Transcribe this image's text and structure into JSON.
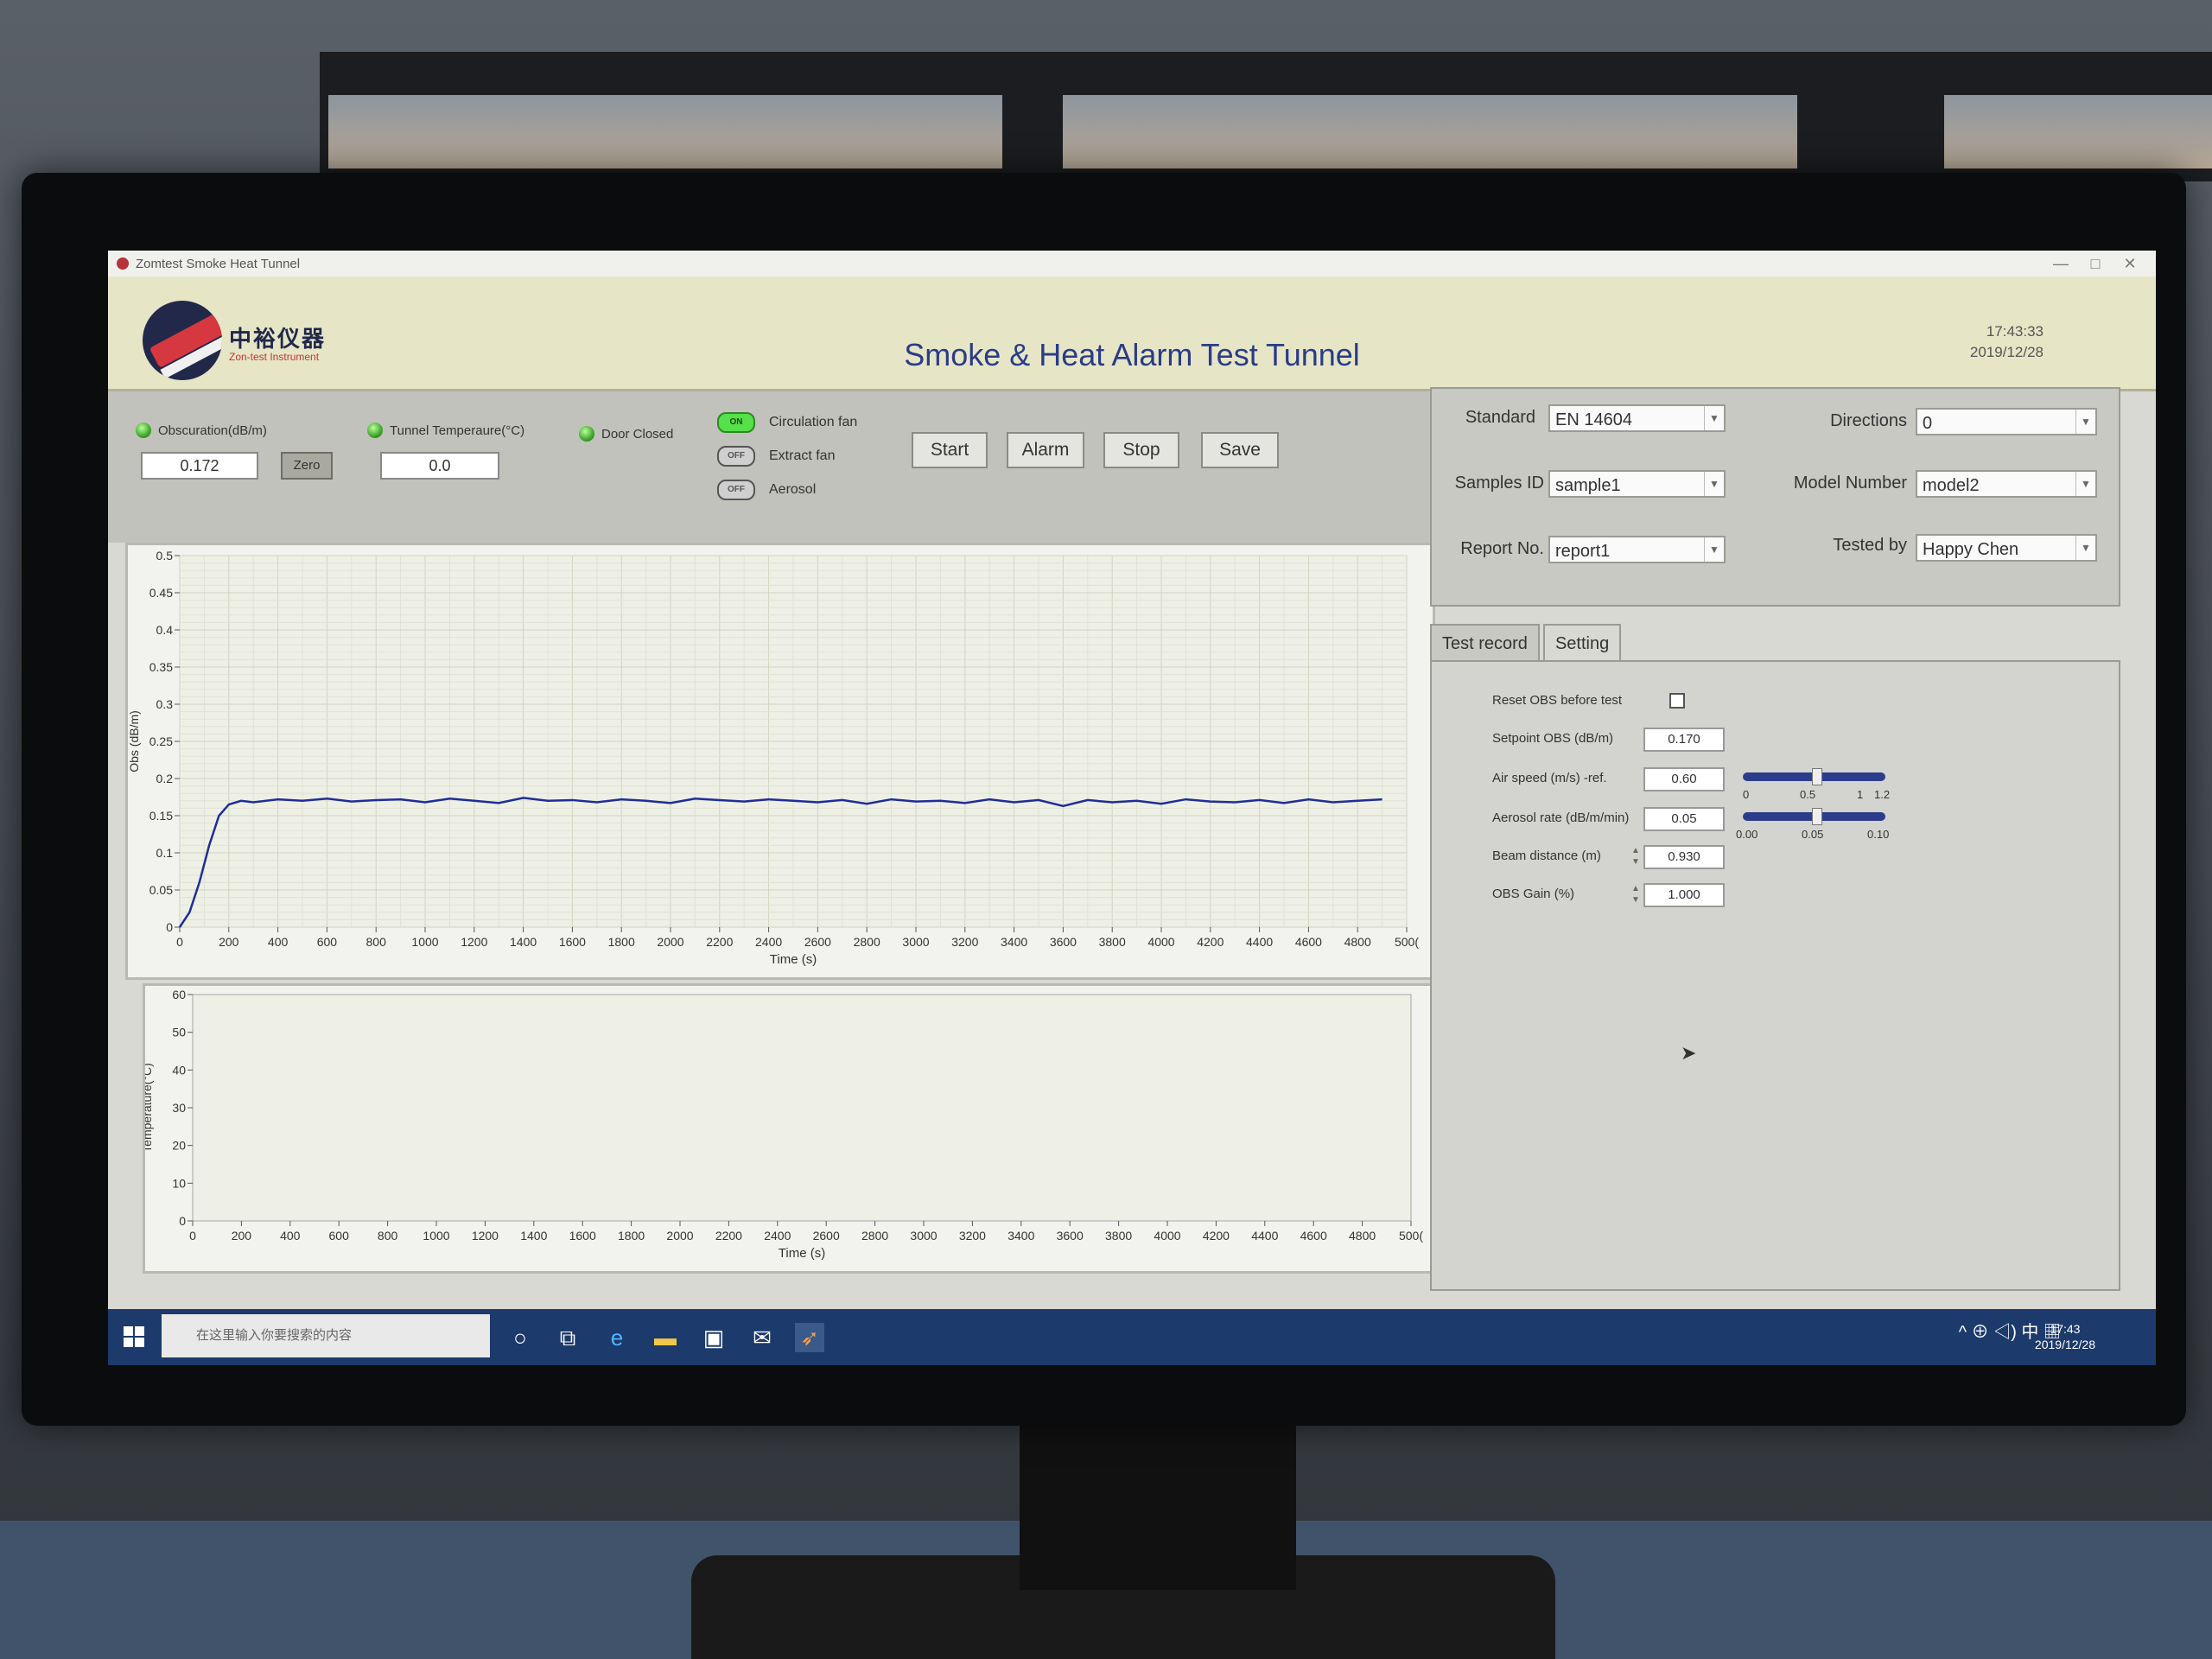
{
  "window": {
    "title": "Zomtest Smoke Heat Tunnel",
    "minimize": "—",
    "maximize": "□",
    "close": "✕"
  },
  "header": {
    "logo_text": "中裕仪器",
    "logo_sub": "Zon-test Instrument",
    "title": "Smoke & Heat Alarm Test Tunnel",
    "time": "17:43:33",
    "date": "2019/12/28"
  },
  "indicators": {
    "obscuration_label": "Obscuration(dB/m)",
    "obscuration_value": "0.172",
    "zero_label": "Zero",
    "temperature_label": "Tunnel Temperaure(°C)",
    "temperature_value": "0.0",
    "door_label": "Door Closed"
  },
  "toggles": [
    {
      "label": "Circulation fan",
      "state": "ON"
    },
    {
      "label": "Extract fan",
      "state": "OFF"
    },
    {
      "label": "Aerosol",
      "state": "OFF"
    }
  ],
  "buttons": {
    "start": "Start",
    "alarm": "Alarm",
    "stop": "Stop",
    "save": "Save"
  },
  "config": {
    "standard_label": "Standard",
    "standard_value": "EN 14604",
    "directions_label": "Directions",
    "directions_value": "0",
    "samples_label": "Samples ID",
    "samples_value": "sample1",
    "model_label": "Model Number",
    "model_value": "model2",
    "report_label": "Report No.",
    "report_value": "report1",
    "tested_label": "Tested by",
    "tested_value": "Happy Chen"
  },
  "tabs": [
    {
      "label": "Test record"
    },
    {
      "label": "Setting"
    }
  ],
  "settings": {
    "reset_label": "Reset OBS before test",
    "setpoint_label": "Setpoint OBS (dB/m)",
    "setpoint_value": "0.170",
    "air_label": "Air speed (m/s) -ref.",
    "air_value": "0.60",
    "aerosol_label": "Aerosol rate (dB/m/min)",
    "aerosol_value": "0.05",
    "beam_label": "Beam distance (m)",
    "beam_value": "0.930",
    "gain_label": "OBS Gain (%)",
    "gain_value": "1.000",
    "air_scale": [
      "0",
      "0.5",
      "1",
      "1.2"
    ],
    "aerosol_scale": [
      "0.00",
      "0.05",
      "0.10"
    ],
    "air_slider_value": 0.6,
    "aerosol_slider_value": 0.05
  },
  "taskbar": {
    "search_placeholder": "在这里输入你要搜索的内容",
    "tray_icons": "^ ⊕ ◁) 中 ▦",
    "time": "17:43",
    "date": "2019/12/28"
  },
  "chart_data": [
    {
      "type": "line",
      "xlabel": "Time (s)",
      "ylabel": "Obs (dB/m)",
      "xlim": [
        0,
        5000
      ],
      "ylim": [
        0,
        0.5
      ],
      "x_ticks": [
        "0",
        "200",
        "400",
        "600",
        "800",
        "1000",
        "1200",
        "1400",
        "1600",
        "1800",
        "2000",
        "2200",
        "2400",
        "2600",
        "2800",
        "3000",
        "3200",
        "3400",
        "3600",
        "3800",
        "4000",
        "4200",
        "4400",
        "4600",
        "4800",
        "500("
      ],
      "y_ticks": [
        "0",
        "0.05",
        "0.1",
        "0.15",
        "0.2",
        "0.25",
        "0.3",
        "0.35",
        "0.4",
        "0.45",
        "0.5"
      ],
      "grid": true,
      "series": [
        {
          "color": "#1f2d9a",
          "x": [
            0,
            40,
            80,
            120,
            160,
            200,
            250,
            300,
            400,
            500,
            600,
            700,
            800,
            900,
            1000,
            1100,
            1200,
            1300,
            1400,
            1500,
            1600,
            1700,
            1800,
            1900,
            2000,
            2100,
            2200,
            2300,
            2400,
            2500,
            2600,
            2700,
            2800,
            2900,
            3000,
            3100,
            3200,
            3300,
            3400,
            3500,
            3600,
            3700,
            3800,
            3900,
            4000,
            4100,
            4200,
            4300,
            4400,
            4500,
            4600,
            4700,
            4800,
            4900
          ],
          "y": [
            0.0,
            0.02,
            0.06,
            0.11,
            0.15,
            0.165,
            0.17,
            0.168,
            0.172,
            0.17,
            0.173,
            0.169,
            0.171,
            0.172,
            0.168,
            0.173,
            0.17,
            0.167,
            0.174,
            0.17,
            0.171,
            0.168,
            0.172,
            0.17,
            0.167,
            0.173,
            0.171,
            0.169,
            0.172,
            0.17,
            0.168,
            0.171,
            0.166,
            0.172,
            0.169,
            0.17,
            0.167,
            0.172,
            0.168,
            0.171,
            0.163,
            0.171,
            0.168,
            0.17,
            0.166,
            0.172,
            0.169,
            0.168,
            0.171,
            0.167,
            0.172,
            0.168,
            0.17,
            0.172
          ]
        }
      ]
    },
    {
      "type": "line",
      "xlabel": "Time (s)",
      "ylabel": "Temperature(°C)",
      "xlim": [
        0,
        5000
      ],
      "ylim": [
        0,
        60
      ],
      "x_ticks": [
        "0",
        "200",
        "400",
        "600",
        "800",
        "1000",
        "1200",
        "1400",
        "1600",
        "1800",
        "2000",
        "2200",
        "2400",
        "2600",
        "2800",
        "3000",
        "3200",
        "3400",
        "3600",
        "3800",
        "4000",
        "4200",
        "4400",
        "4600",
        "4800",
        "500("
      ],
      "y_ticks": [
        "0",
        "10",
        "20",
        "30",
        "40",
        "50",
        "60"
      ],
      "grid": false,
      "series": []
    }
  ]
}
